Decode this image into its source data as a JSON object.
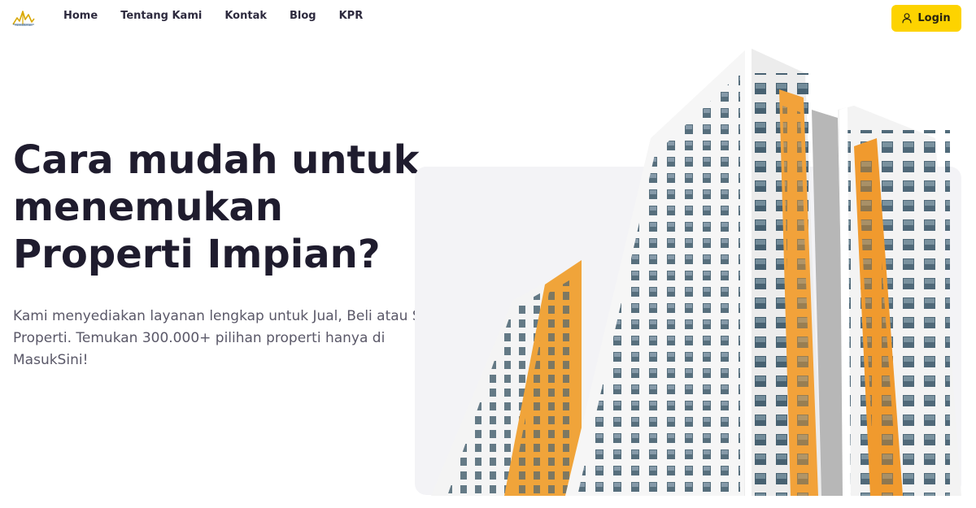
{
  "brand": {
    "logo_text": "MasukSini",
    "accent_color": "#fdd300"
  },
  "nav": {
    "links": [
      {
        "label": "Home"
      },
      {
        "label": "Tentang Kami"
      },
      {
        "label": "Kontak"
      },
      {
        "label": "Blog"
      },
      {
        "label": "KPR"
      }
    ],
    "login_label": "Login",
    "login_icon": "user-icon"
  },
  "hero": {
    "title": "Cara mudah untuk menemukan Properti Impian?",
    "description": "Kami menyediakan layanan lengkap untuk Jual, Beli atau Sewa Properti. Temukan 300.000+ pilihan properti hanya di MasukSini!",
    "image": "apartment-building-photo"
  }
}
